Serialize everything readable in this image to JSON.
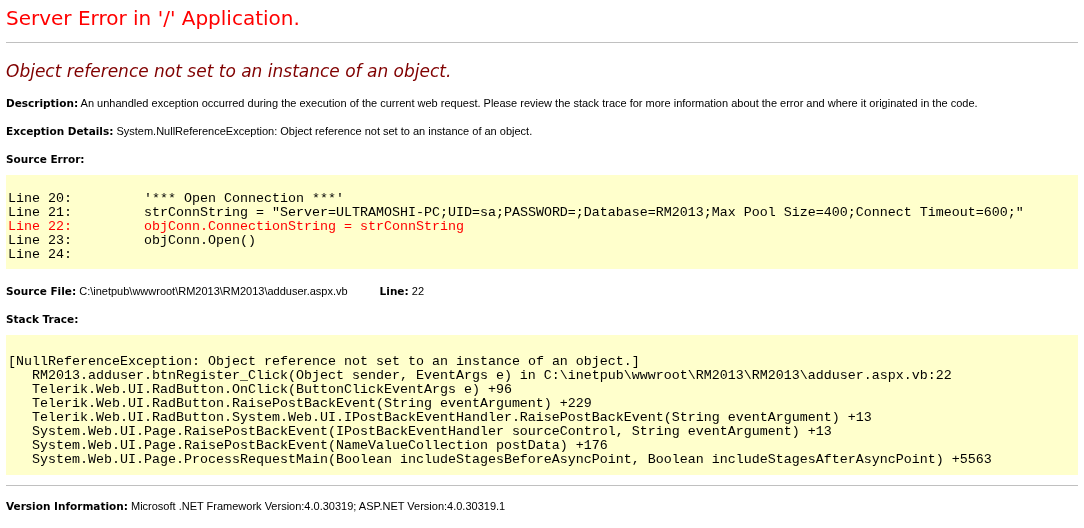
{
  "title": "Server Error in '/' Application.",
  "message": "Object reference not set to an instance of an object.",
  "description": "**Description:** An unhandled exception occurred during the execution of the current web request. Please review the stack trace for more information about the error and where it originated in the code.",
  "exception_details": "**Exception Details:** System.NullReferenceException: Object reference not set to an instance of an object.",
  "source_error": {
    "heading": "Source Error:",
    "lines": [
      {
        "label": "Line 20:",
        "code": "'*** Open Connection ***'",
        "highlighted": false
      },
      {
        "label": "Line 21:",
        "code": "strConnString = \"Server=ULTRAMOSHI-PC;UID=sa;PASSWORD=;Database=RM2013;Max Pool Size=400;Connect Timeout=600;\"",
        "highlighted": false
      },
      {
        "label": "Line 22:",
        "code": "objConn.ConnectionString = strConnString",
        "highlighted": true
      },
      {
        "label": "Line 23:",
        "code": "objConn.Open()",
        "highlighted": false
      },
      {
        "label": "Line 24:",
        "highlighted": false
      }
    ]
  },
  "source_file": "**Source File:** C:\\inetpub\\wwwroot\\RM2013\\RM2013\\adduser.aspx.vb",
  "source_line": "**Line:** 22",
  "stack_trace": {
    "heading": "Stack Trace:",
    "exception": "[NullReferenceException: Object reference not set to an instance of an object.]",
    "frames": [
      "RM2013.adduser.btnRegister_Click(Object sender, EventArgs e) in C:\\inetpub\\wwwroot\\RM2013\\RM2013\\adduser.aspx.vb:22",
      "Telerik.Web.UI.RadButton.OnClick(ButtonClickEventArgs e) +96",
      "Telerik.Web.UI.RadButton.RaisePostBackEvent(String eventArgument) +229",
      "Telerik.Web.UI.RadButton.System.Web.UI.IPostBackEventHandler.RaisePostBackEvent(String eventArgument) +13",
      "System.Web.UI.Page.RaisePostBackEvent(IPostBackEventHandler sourceControl, String eventArgument) +13",
      "System.Web.UI.Page.RaisePostBackEvent(NameValueCollection postData) +176",
      "System.Web.UI.Page.ProcessRequestMain(Boolean includeStagesBeforeAsyncPoint, Boolean includeStagesAfterAsyncPoint) +5563"
    ]
  },
  "version_info": "**Version Information:** Microsoft .NET Framework Version:4.0.30319; ASP.NET Version:4.0.30319.1"
}
